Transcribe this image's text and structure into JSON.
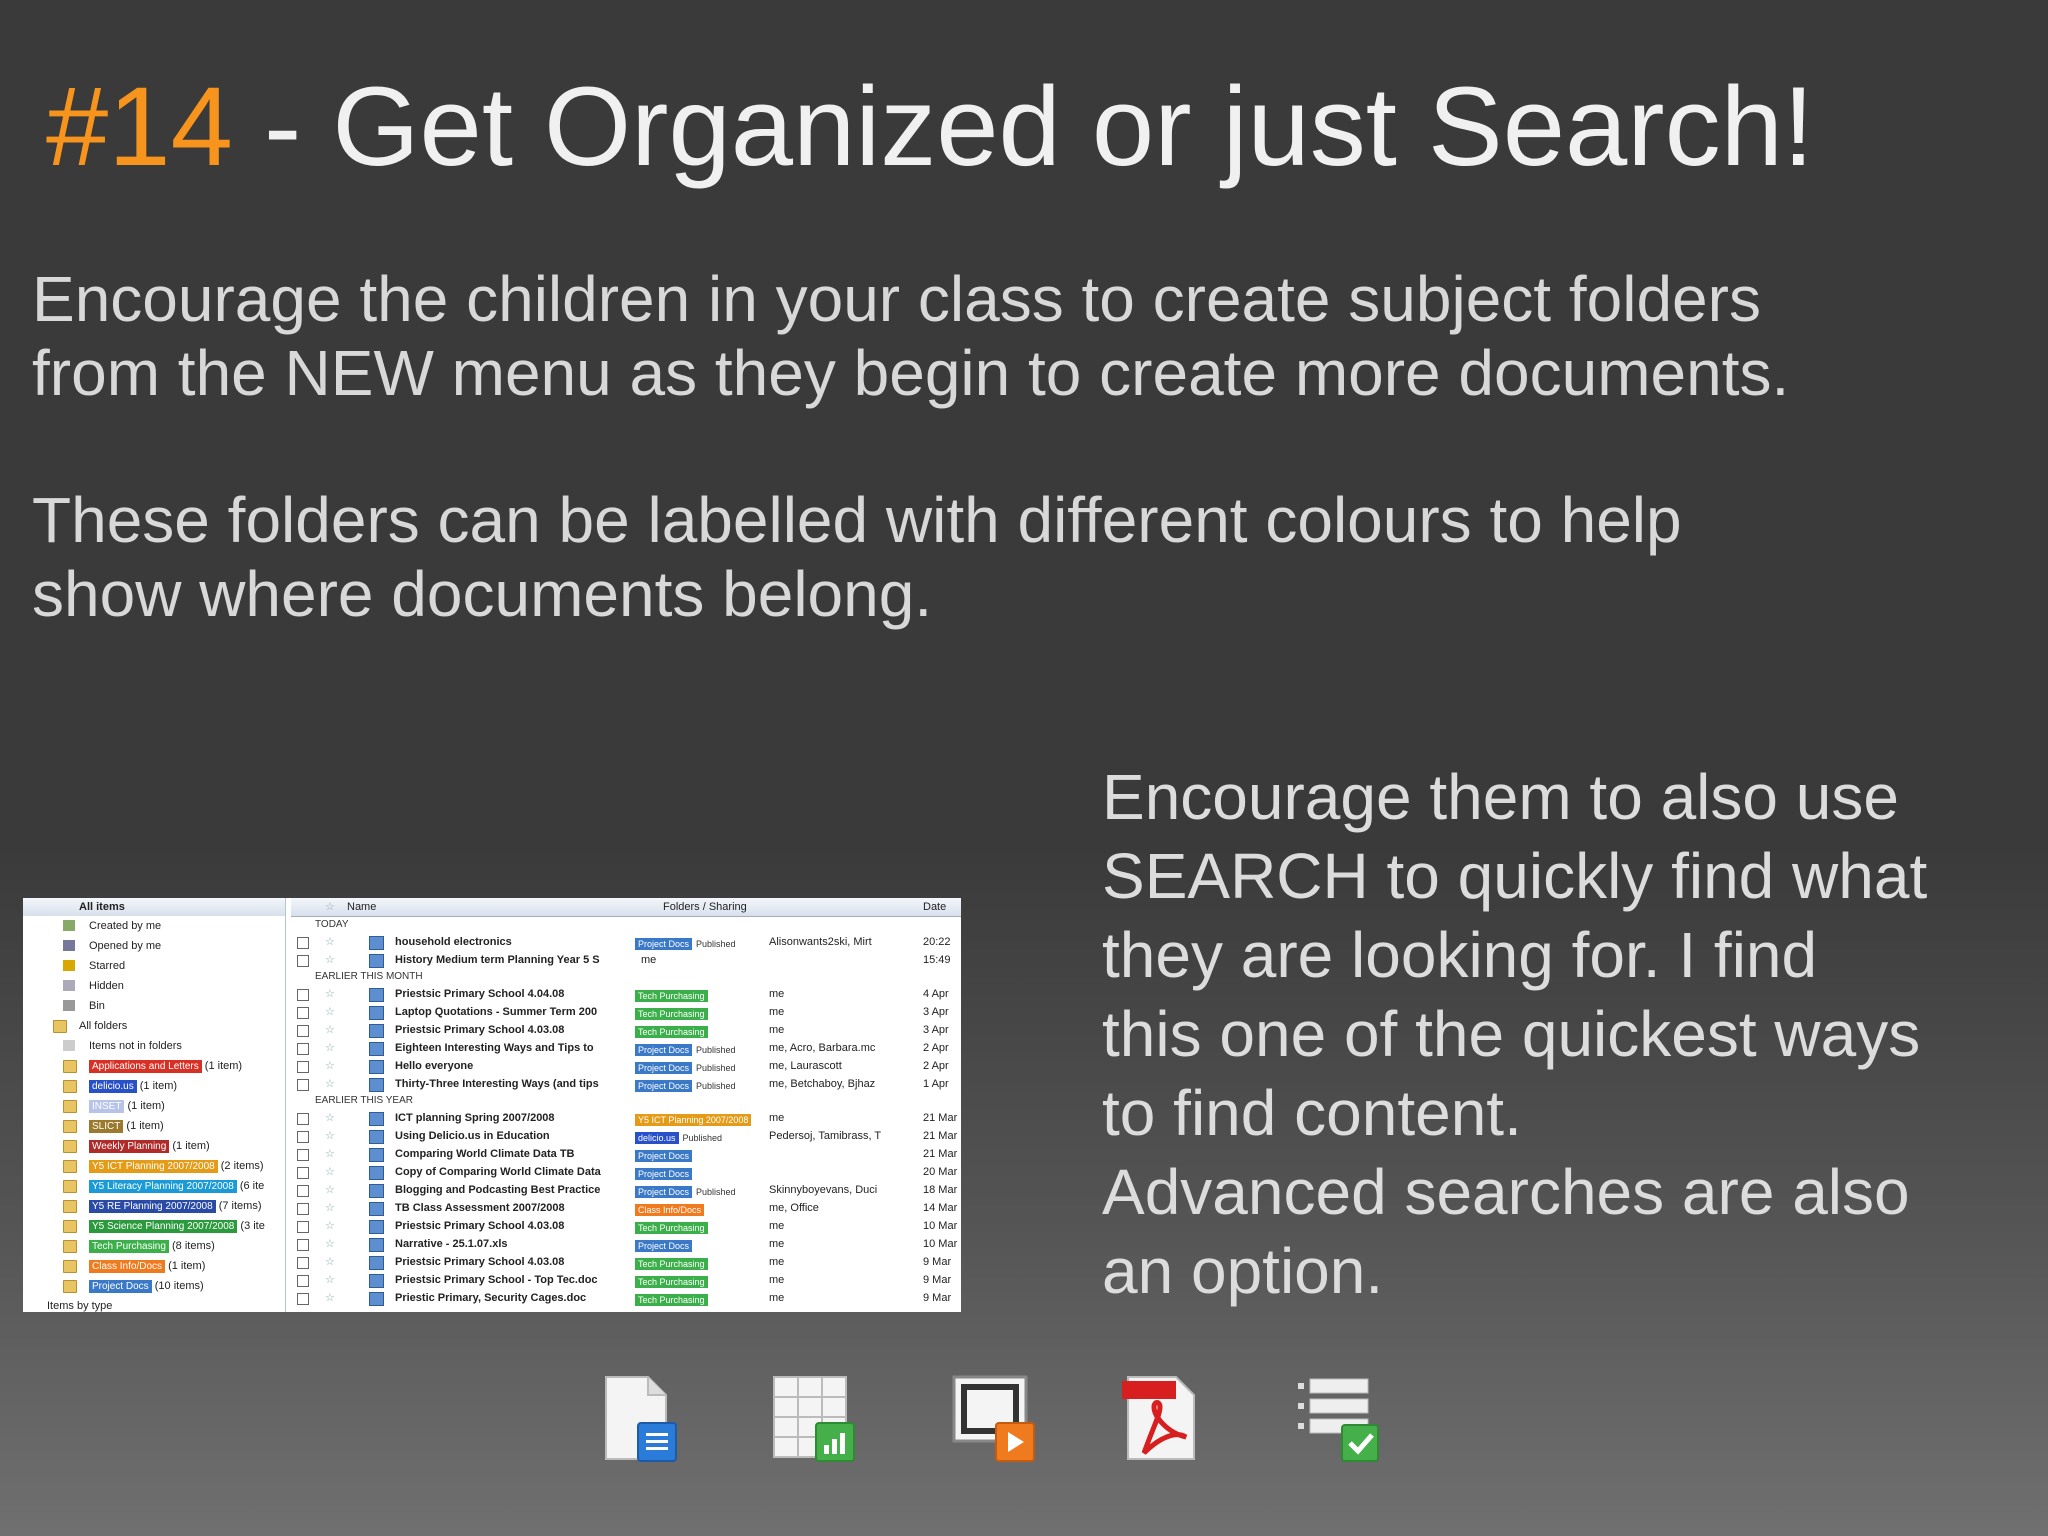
{
  "title": {
    "number": "#14",
    "text": " - Get Organized or just Search!"
  },
  "paragraphs": {
    "p1_l1": "Encourage the children in your class to create subject folders",
    "p1_l2": "from the NEW menu as they begin to create more documents.",
    "p2_l1": "These folders can be labelled with different colours to help",
    "p2_l2": "show where documents belong."
  },
  "side": {
    "l1": "Encourage them to also use",
    "l2": "SEARCH to quickly find what",
    "l3": "they are looking for. I find",
    "l4": "this one of the quickest ways",
    "l5": "to find content.",
    "l6": "Advanced searches are also",
    "l7": "an option."
  },
  "tree": {
    "header": "All items",
    "items": [
      "Created by me",
      "Opened by me",
      "Starred",
      "Hidden",
      "Bin"
    ],
    "all_folders": "All folders",
    "not_in_folders": "Items not in folders",
    "folders": [
      {
        "label": "Applications and Letters",
        "count": "(1 item)",
        "color": "#d93025"
      },
      {
        "label": "delicio.us",
        "count": "(1 item)",
        "color": "#2850c8"
      },
      {
        "label": "INSET",
        "count": "(1 item)",
        "color": "#b7c3e8"
      },
      {
        "label": "SLICT",
        "count": "(1 item)",
        "color": "#9b7a2e"
      },
      {
        "label": "Weekly Planning",
        "count": "(1 item)",
        "color": "#b02a2a"
      },
      {
        "label": "Y5 ICT Planning 2007/2008",
        "count": "(2 items)",
        "color": "#e49c18"
      },
      {
        "label": "Y5 Literacy Planning 2007/2008",
        "count": "(6 ite",
        "color": "#1a9ad6"
      },
      {
        "label": "Y5 RE Planning 2007/2008",
        "count": "(7 items)",
        "color": "#2a4aa8"
      },
      {
        "label": "Y5 Science Planning 2007/2008",
        "count": "(3 ite",
        "color": "#2b9a3c"
      },
      {
        "label": "Tech Purchasing",
        "count": "(8 items)",
        "color": "#3bb04a"
      },
      {
        "label": "Class Info/Docs",
        "count": "(1 item)",
        "color": "#f07a1e"
      },
      {
        "label": "Project Docs",
        "count": "(10 items)",
        "color": "#3a78c8"
      }
    ],
    "by_type": "Items by type"
  },
  "grid": {
    "headers": {
      "name": "Name",
      "folders": "Folders / Sharing",
      "date": "Date"
    },
    "sections": [
      {
        "label": "TODAY",
        "rows": [
          {
            "name": "household electronics",
            "tag": "Project Docs",
            "tagc": "#3a78c8",
            "pub": "Published",
            "owner": "Alisonwants2ski, Mirt",
            "date": "20:22"
          },
          {
            "name": "History Medium term Planning Year 5 S",
            "tag": "",
            "tagc": "",
            "pub": "",
            "owner": "me",
            "date": "15:49"
          }
        ]
      },
      {
        "label": "EARLIER THIS MONTH",
        "rows": [
          {
            "name": "Priestsic Primary School 4.04.08",
            "tag": "Tech Purchasing",
            "tagc": "#3bb04a",
            "pub": "",
            "owner": "me",
            "date": "4 Apr"
          },
          {
            "name": "Laptop Quotations - Summer Term 200",
            "tag": "Tech Purchasing",
            "tagc": "#3bb04a",
            "pub": "",
            "owner": "me",
            "date": "3 Apr"
          },
          {
            "name": "Priestsic Primary School 4.03.08",
            "tag": "Tech Purchasing",
            "tagc": "#3bb04a",
            "pub": "",
            "owner": "me",
            "date": "3 Apr"
          },
          {
            "name": "Eighteen Interesting Ways and Tips to",
            "tag": "Project Docs",
            "tagc": "#3a78c8",
            "pub": "Published",
            "owner": "me, Acro, Barbara.mc",
            "date": "2 Apr"
          },
          {
            "name": "Hello everyone",
            "tag": "Project Docs",
            "tagc": "#3a78c8",
            "pub": "Published",
            "owner": "me, Laurascott",
            "date": "2 Apr"
          },
          {
            "name": "Thirty-Three Interesting Ways (and tips",
            "tag": "Project Docs",
            "tagc": "#3a78c8",
            "pub": "Published",
            "owner": "me, Betchaboy, Bjhaz",
            "date": "1 Apr"
          }
        ]
      },
      {
        "label": "EARLIER THIS YEAR",
        "rows": [
          {
            "name": "ICT planning Spring 2007/2008",
            "tag": "Y5 ICT Planning 2007/2008",
            "tagc": "#e49c18",
            "pub": "",
            "owner": "me",
            "date": "21 Mar"
          },
          {
            "name": "Using Delicio.us in Education",
            "tag": "delicio.us",
            "tagc": "#2850c8",
            "pub": "Published",
            "owner": "Pedersoj, Tamibrass, T",
            "date": "21 Mar"
          },
          {
            "name": "Comparing World Climate Data TB",
            "tag": "Project Docs",
            "tagc": "#3a78c8",
            "pub": "",
            "owner": "",
            "date": "21 Mar"
          },
          {
            "name": "Copy of Comparing World Climate Data",
            "tag": "Project Docs",
            "tagc": "#3a78c8",
            "pub": "",
            "owner": "",
            "date": "20 Mar"
          },
          {
            "name": "Blogging and Podcasting Best Practice",
            "tag": "Project Docs",
            "tagc": "#3a78c8",
            "pub": "Published",
            "owner": "Skinnyboyevans, Duci",
            "date": "18 Mar"
          },
          {
            "name": "TB Class Assessment 2007/2008",
            "tag": "Class Info/Docs",
            "tagc": "#f07a1e",
            "pub": "",
            "owner": "me, Office",
            "date": "14 Mar"
          },
          {
            "name": "Priestsic Primary School 4.03.08",
            "tag": "Tech Purchasing",
            "tagc": "#3bb04a",
            "pub": "",
            "owner": "me",
            "date": "10 Mar"
          },
          {
            "name": "Narrative - 25.1.07.xls",
            "tag": "Project Docs",
            "tagc": "#3a78c8",
            "pub": "",
            "owner": "me",
            "date": "10 Mar"
          },
          {
            "name": "Priestsic Primary School 4.03.08",
            "tag": "Tech Purchasing",
            "tagc": "#3bb04a",
            "pub": "",
            "owner": "me",
            "date": "9 Mar"
          },
          {
            "name": "Priestsic Primary School - Top Tec.doc",
            "tag": "Tech Purchasing",
            "tagc": "#3bb04a",
            "pub": "",
            "owner": "me",
            "date": "9 Mar"
          },
          {
            "name": "Priestic Primary, Security Cages.doc",
            "tag": "Tech Purchasing",
            "tagc": "#3bb04a",
            "pub": "",
            "owner": "me",
            "date": "9 Mar"
          }
        ]
      }
    ]
  },
  "icons": [
    "document-icon",
    "spreadsheet-icon",
    "presentation-icon",
    "pdf-icon",
    "form-icon"
  ]
}
